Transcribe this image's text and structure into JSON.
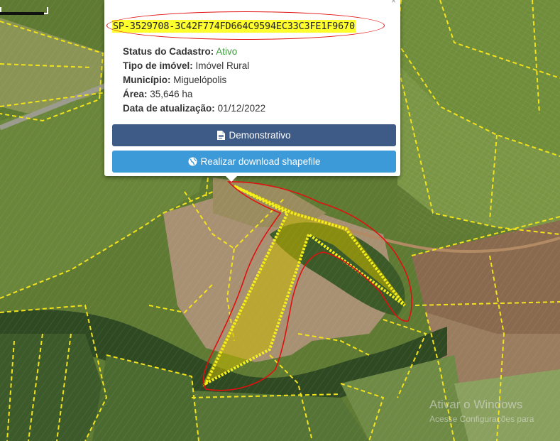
{
  "popup": {
    "car_code": "SP-3529708-3C42F774FD664C9594EC33C3FE1F9670",
    "close_glyph": "×",
    "fields": [
      {
        "label": "Status do Cadastro:",
        "value": "Ativo"
      },
      {
        "label": "Tipo de imóvel:",
        "value": "Imóvel Rural"
      },
      {
        "label": "Município:",
        "value": "Miguelópolis"
      },
      {
        "label": "Área:",
        "value": "35,646 ha"
      },
      {
        "label": "Data de atualização:",
        "value": "01/12/2022"
      }
    ],
    "button_demo": "Demonstrativo",
    "button_download": "Realizar download shapefile",
    "icon_demo": "file-icon",
    "icon_download": "globe-icon"
  },
  "watermark": {
    "line1": "Ativar o Windows",
    "line2": "Acesse Configurações para"
  },
  "colors": {
    "parcel_border": "#f2e21c",
    "highlight_fill": "#c8b800",
    "annotation_red": "#e01010",
    "button_dark": "#3e5a86",
    "button_light": "#3d9ad9",
    "status_active": "#3c9a3c"
  }
}
